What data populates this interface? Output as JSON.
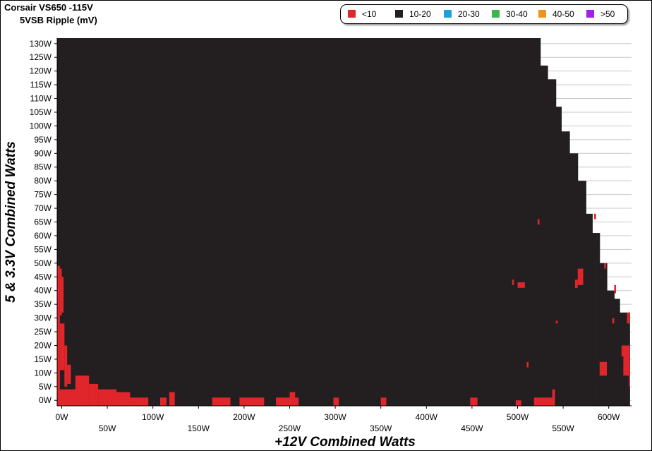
{
  "header": {
    "title_line1": "Corsair VS650 -115V",
    "title_line2": "5VSB Ripple (mV)"
  },
  "legend": [
    {
      "label": "<10",
      "color": "#e0262b"
    },
    {
      "label": "10-20",
      "color": "#231f20"
    },
    {
      "label": "20-30",
      "color": "#1ea0d8"
    },
    {
      "label": "30-40",
      "color": "#3db54a"
    },
    {
      "label": "40-50",
      "color": "#f0921e"
    },
    {
      "label": ">50",
      "color": "#a020f0"
    }
  ],
  "chart_data": {
    "type": "heatmap",
    "title": "Corsair VS650 -115V",
    "subtitle": "5VSB Ripple (mV)",
    "xlabel": "+12V Combined Watts",
    "ylabel": "5 & 3.3V Combined Watts",
    "xlim": [
      -5,
      625
    ],
    "ylim": [
      -2,
      132
    ],
    "x_ticks": [
      0,
      50,
      100,
      150,
      200,
      250,
      300,
      350,
      400,
      450,
      500,
      550,
      600
    ],
    "x_tick_labels": [
      "0W",
      "50W",
      "100W",
      "150W",
      "200W",
      "250W",
      "300W",
      "350W",
      "400W",
      "450W",
      "500W",
      "550W",
      "600W"
    ],
    "y_ticks": [
      0,
      5,
      10,
      15,
      20,
      25,
      30,
      35,
      40,
      45,
      50,
      55,
      60,
      65,
      70,
      75,
      80,
      85,
      90,
      95,
      100,
      105,
      110,
      115,
      120,
      125,
      130
    ],
    "y_tick_labels": [
      "0W",
      "5W",
      "10W",
      "15W",
      "20W",
      "25W",
      "30W",
      "35W",
      "40W",
      "45W",
      "50W",
      "55W",
      "60W",
      "65W",
      "70W",
      "75W",
      "80W",
      "85W",
      "90W",
      "95W",
      "100W",
      "105W",
      "110W",
      "115W",
      "120W",
      "125W",
      "130W"
    ],
    "grid": true,
    "legend_position": "top-right",
    "background_category": "10-20",
    "max_combined_boundary": [
      {
        "x": 525,
        "ymax": 132
      },
      {
        "x": 533,
        "ymax": 122
      },
      {
        "x": 542,
        "ymax": 117
      },
      {
        "x": 548,
        "ymax": 107
      },
      {
        "x": 557,
        "ymax": 98
      },
      {
        "x": 566,
        "ymax": 90
      },
      {
        "x": 575,
        "ymax": 80
      },
      {
        "x": 582,
        "ymax": 68
      },
      {
        "x": 590,
        "ymax": 61
      },
      {
        "x": 598,
        "ymax": 50
      },
      {
        "x": 606,
        "ymax": 40
      },
      {
        "x": 612,
        "ymax": 37
      },
      {
        "x": 618,
        "ymax": 32
      },
      {
        "x": 623,
        "ymax": 32
      }
    ],
    "regions_lt10": [
      {
        "x0": -5,
        "x1": -2,
        "y0": 2,
        "y1": 49
      },
      {
        "x0": -2,
        "x1": 0,
        "y0": 31,
        "y1": 48
      },
      {
        "x0": 0,
        "x1": 2,
        "y0": 32,
        "y1": 45
      },
      {
        "x0": -2,
        "x1": 3,
        "y0": 11,
        "y1": 28
      },
      {
        "x0": 3,
        "x1": 6,
        "y0": 5,
        "y1": 20
      },
      {
        "x0": 6,
        "x1": 10,
        "y0": 6,
        "y1": 13
      },
      {
        "x0": -5,
        "x1": 20,
        "y0": -2,
        "y1": 4
      },
      {
        "x0": 15,
        "x1": 30,
        "y0": -2,
        "y1": 9
      },
      {
        "x0": 30,
        "x1": 40,
        "y0": -2,
        "y1": 6
      },
      {
        "x0": 40,
        "x1": 60,
        "y0": -2,
        "y1": 4
      },
      {
        "x0": 60,
        "x1": 75,
        "y0": -2,
        "y1": 3
      },
      {
        "x0": 75,
        "x1": 95,
        "y0": -2,
        "y1": 1
      },
      {
        "x0": 108,
        "x1": 115,
        "y0": -2,
        "y1": 1
      },
      {
        "x0": 118,
        "x1": 124,
        "y0": -2,
        "y1": 3
      },
      {
        "x0": 165,
        "x1": 185,
        "y0": -2,
        "y1": 1
      },
      {
        "x0": 195,
        "x1": 222,
        "y0": -2,
        "y1": 1
      },
      {
        "x0": 235,
        "x1": 260,
        "y0": -2,
        "y1": 1
      },
      {
        "x0": 250,
        "x1": 256,
        "y0": -2,
        "y1": 3
      },
      {
        "x0": 298,
        "x1": 304,
        "y0": -2,
        "y1": 1
      },
      {
        "x0": 350,
        "x1": 356,
        "y0": -2,
        "y1": 1
      },
      {
        "x0": 448,
        "x1": 456,
        "y0": -2,
        "y1": 1
      },
      {
        "x0": 498,
        "x1": 504,
        "y0": -2,
        "y1": 0
      },
      {
        "x0": 518,
        "x1": 540,
        "y0": -2,
        "y1": 1
      },
      {
        "x0": 538,
        "x1": 541,
        "y0": -2,
        "y1": 4
      },
      {
        "x0": 500,
        "x1": 508,
        "y0": 41,
        "y1": 43
      },
      {
        "x0": 494,
        "x1": 496,
        "y0": 42,
        "y1": 44
      },
      {
        "x0": 522,
        "x1": 524,
        "y0": 64,
        "y1": 66
      },
      {
        "x0": 566,
        "x1": 572,
        "y0": 42,
        "y1": 48
      },
      {
        "x0": 563,
        "x1": 566,
        "y0": 41,
        "y1": 44
      },
      {
        "x0": 584,
        "x1": 586,
        "y0": 66,
        "y1": 68
      },
      {
        "x0": 595,
        "x1": 597,
        "y0": 48,
        "y1": 50
      },
      {
        "x0": 606,
        "x1": 608,
        "y0": 39,
        "y1": 42
      },
      {
        "x0": 590,
        "x1": 598,
        "y0": 9,
        "y1": 14
      },
      {
        "x0": 510,
        "x1": 512,
        "y0": 12,
        "y1": 14
      },
      {
        "x0": 542,
        "x1": 544,
        "y0": 28,
        "y1": 29
      },
      {
        "x0": 604,
        "x1": 606,
        "y0": 28,
        "y1": 30
      },
      {
        "x0": 614,
        "x1": 623,
        "y0": 16,
        "y1": 20
      },
      {
        "x0": 616,
        "x1": 623,
        "y0": 9,
        "y1": 16
      },
      {
        "x0": 620,
        "x1": 623,
        "y0": 28,
        "y1": 32
      },
      {
        "x0": 622,
        "x1": 623,
        "y0": 5,
        "y1": 10
      }
    ]
  }
}
